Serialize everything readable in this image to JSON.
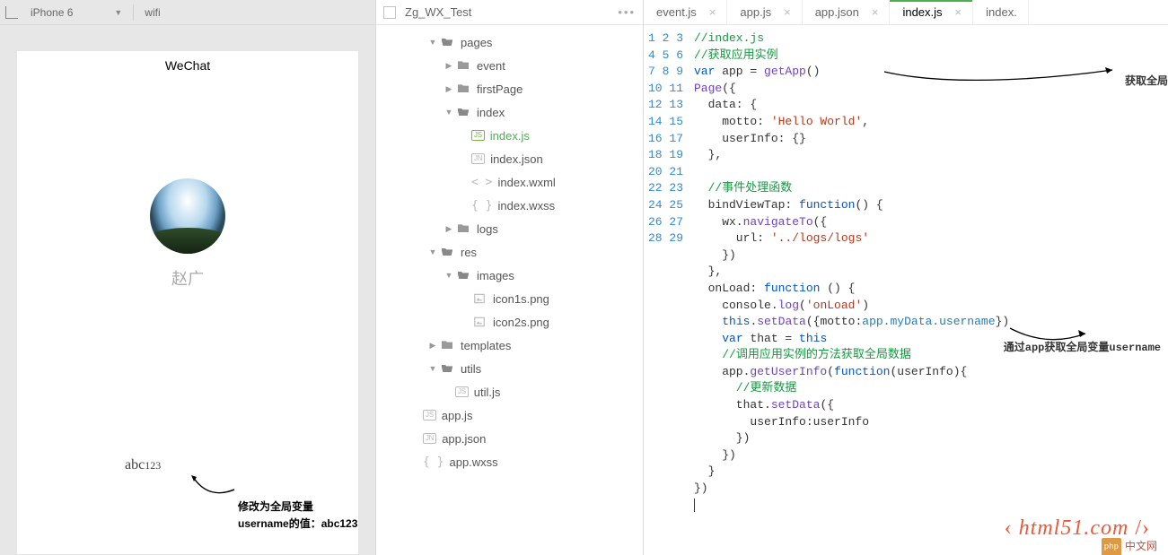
{
  "simulator": {
    "device": "iPhone 6",
    "network": "wifi",
    "appTitle": "WeChat",
    "nickname": "赵广",
    "motto": "abc",
    "mottoNum": "123",
    "annotation": "修改为全局变量username的值：abc123"
  },
  "explorer": {
    "project": "Zg_WX_Test",
    "tree": [
      {
        "depth": 0,
        "kind": "folder",
        "open": true,
        "label": "pages"
      },
      {
        "depth": 1,
        "kind": "folder",
        "open": false,
        "label": "event"
      },
      {
        "depth": 1,
        "kind": "folder",
        "open": false,
        "label": "firstPage"
      },
      {
        "depth": 1,
        "kind": "folder",
        "open": true,
        "label": "index"
      },
      {
        "depth": 2,
        "kind": "file",
        "badge": "JS",
        "badgeClass": "js",
        "label": "index.js",
        "active": true
      },
      {
        "depth": 2,
        "kind": "file",
        "badge": "JN",
        "label": "index.json"
      },
      {
        "depth": 2,
        "kind": "file",
        "angle": true,
        "label": "index.wxml"
      },
      {
        "depth": 2,
        "kind": "file",
        "curly": true,
        "label": "index.wxss"
      },
      {
        "depth": 1,
        "kind": "folder",
        "open": false,
        "label": "logs"
      },
      {
        "depth": 0,
        "kind": "folder",
        "open": true,
        "label": "res"
      },
      {
        "depth": 1,
        "kind": "folder",
        "open": true,
        "label": "images"
      },
      {
        "depth": 2,
        "kind": "file",
        "img": true,
        "label": "icon1s.png"
      },
      {
        "depth": 2,
        "kind": "file",
        "img": true,
        "label": "icon2s.png"
      },
      {
        "depth": 0,
        "kind": "folder",
        "open": false,
        "label": "templates"
      },
      {
        "depth": 0,
        "kind": "folder",
        "open": true,
        "label": "utils"
      },
      {
        "depth": 1,
        "kind": "file",
        "badge": "JS",
        "label": "util.js"
      },
      {
        "depth": -1,
        "kind": "file",
        "badge": "JS",
        "label": "app.js"
      },
      {
        "depth": -1,
        "kind": "file",
        "badge": "JN",
        "label": "app.json"
      },
      {
        "depth": -1,
        "kind": "file",
        "curly": true,
        "label": "app.wxss"
      }
    ]
  },
  "editor": {
    "tabs": [
      {
        "label": "event.js",
        "active": false
      },
      {
        "label": "app.js",
        "active": false
      },
      {
        "label": "app.json",
        "active": false
      },
      {
        "label": "index.js",
        "active": true
      },
      {
        "label": "index.",
        "active": false,
        "nocross": true
      }
    ],
    "annotation1": "获取全局app",
    "annotation2": "通过app获取全局变量username",
    "code": [
      [
        {
          "c": "c-com",
          "t": "//index.js"
        }
      ],
      [
        {
          "c": "c-com",
          "t": "//获取应用实例"
        }
      ],
      [
        {
          "c": "c-kw",
          "t": "var"
        },
        {
          "t": " app = "
        },
        {
          "c": "c-fn",
          "t": "getApp"
        },
        {
          "t": "()"
        }
      ],
      [
        {
          "c": "c-fn",
          "t": "Page"
        },
        {
          "t": "({"
        }
      ],
      [
        {
          "t": "  data: {"
        }
      ],
      [
        {
          "t": "    motto: "
        },
        {
          "c": "c-str",
          "t": "'Hello World'"
        },
        {
          "t": ","
        }
      ],
      [
        {
          "t": "    userInfo: {}"
        }
      ],
      [
        {
          "t": "  },"
        }
      ],
      [],
      [
        {
          "t": "  "
        },
        {
          "c": "c-com",
          "t": "//事件处理函数"
        }
      ],
      [
        {
          "t": "  bindViewTap: "
        },
        {
          "c": "c-kw",
          "t": "function"
        },
        {
          "t": "() {"
        }
      ],
      [
        {
          "t": "    wx."
        },
        {
          "c": "c-fn",
          "t": "navigateTo"
        },
        {
          "t": "({"
        }
      ],
      [
        {
          "t": "      url: "
        },
        {
          "c": "c-str",
          "t": "'../logs/logs'"
        }
      ],
      [
        {
          "t": "    })"
        }
      ],
      [
        {
          "t": "  },"
        }
      ],
      [
        {
          "t": "  onLoad: "
        },
        {
          "c": "c-kw",
          "t": "function"
        },
        {
          "t": " () {"
        }
      ],
      [
        {
          "t": "    console."
        },
        {
          "c": "c-fn",
          "t": "log"
        },
        {
          "t": "("
        },
        {
          "c": "c-str",
          "t": "'onLoad'"
        },
        {
          "t": ")"
        }
      ],
      [
        {
          "t": "    "
        },
        {
          "c": "c-kw",
          "t": "this"
        },
        {
          "t": "."
        },
        {
          "c": "c-fn",
          "t": "setData"
        },
        {
          "t": "({motto:"
        },
        {
          "c": "c-id",
          "t": "app.myData.username"
        },
        {
          "t": "})"
        }
      ],
      [
        {
          "t": "    "
        },
        {
          "c": "c-kw",
          "t": "var"
        },
        {
          "t": " that = "
        },
        {
          "c": "c-kw",
          "t": "this"
        }
      ],
      [
        {
          "t": "    "
        },
        {
          "c": "c-com",
          "t": "//调用应用实例的方法获取全局数据"
        }
      ],
      [
        {
          "t": "    app."
        },
        {
          "c": "c-fn",
          "t": "getUserInfo"
        },
        {
          "t": "("
        },
        {
          "c": "c-kw",
          "t": "function"
        },
        {
          "t": "(userInfo){"
        }
      ],
      [
        {
          "t": "      "
        },
        {
          "c": "c-com",
          "t": "//更新数据"
        }
      ],
      [
        {
          "t": "      that."
        },
        {
          "c": "c-fn",
          "t": "setData"
        },
        {
          "t": "({"
        }
      ],
      [
        {
          "t": "        userInfo:userInfo"
        }
      ],
      [
        {
          "t": "      })"
        }
      ],
      [
        {
          "t": "    })"
        }
      ],
      [
        {
          "t": "  }"
        }
      ],
      [
        {
          "t": "})"
        }
      ],
      []
    ]
  },
  "watermarks": {
    "big": "html51.com",
    "bigTag": "‹ /›",
    "small_logo": "php",
    "small": "中文网"
  }
}
